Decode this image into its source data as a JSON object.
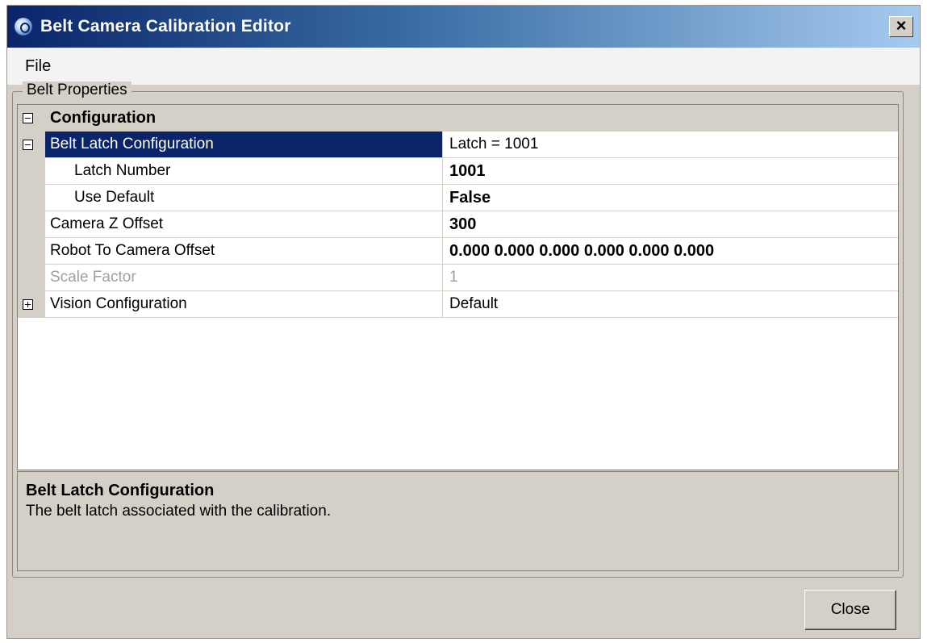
{
  "window": {
    "title": "Belt Camera Calibration Editor",
    "close_glyph": "×"
  },
  "menu": {
    "items": [
      "File"
    ]
  },
  "group": {
    "label": "Belt Properties"
  },
  "grid": {
    "category": "Configuration",
    "rows": [
      {
        "name": "Belt Latch Configuration",
        "value": "Latch = 1001"
      },
      {
        "name": "Latch Number",
        "value": "1001"
      },
      {
        "name": "Use Default",
        "value": "False"
      },
      {
        "name": "Camera Z Offset",
        "value": "300"
      },
      {
        "name": "Robot To Camera Offset",
        "value": "0.000 0.000 0.000 0.000 0.000 0.000"
      },
      {
        "name": "Scale Factor",
        "value": "1"
      },
      {
        "name": "Vision Configuration",
        "value": "Default"
      }
    ]
  },
  "help": {
    "title": "Belt Latch Configuration",
    "description": "The belt latch associated with the calibration."
  },
  "buttons": {
    "close": "Close"
  },
  "colors": {
    "selection": "#0a246a",
    "face": "#d4d0c8"
  }
}
